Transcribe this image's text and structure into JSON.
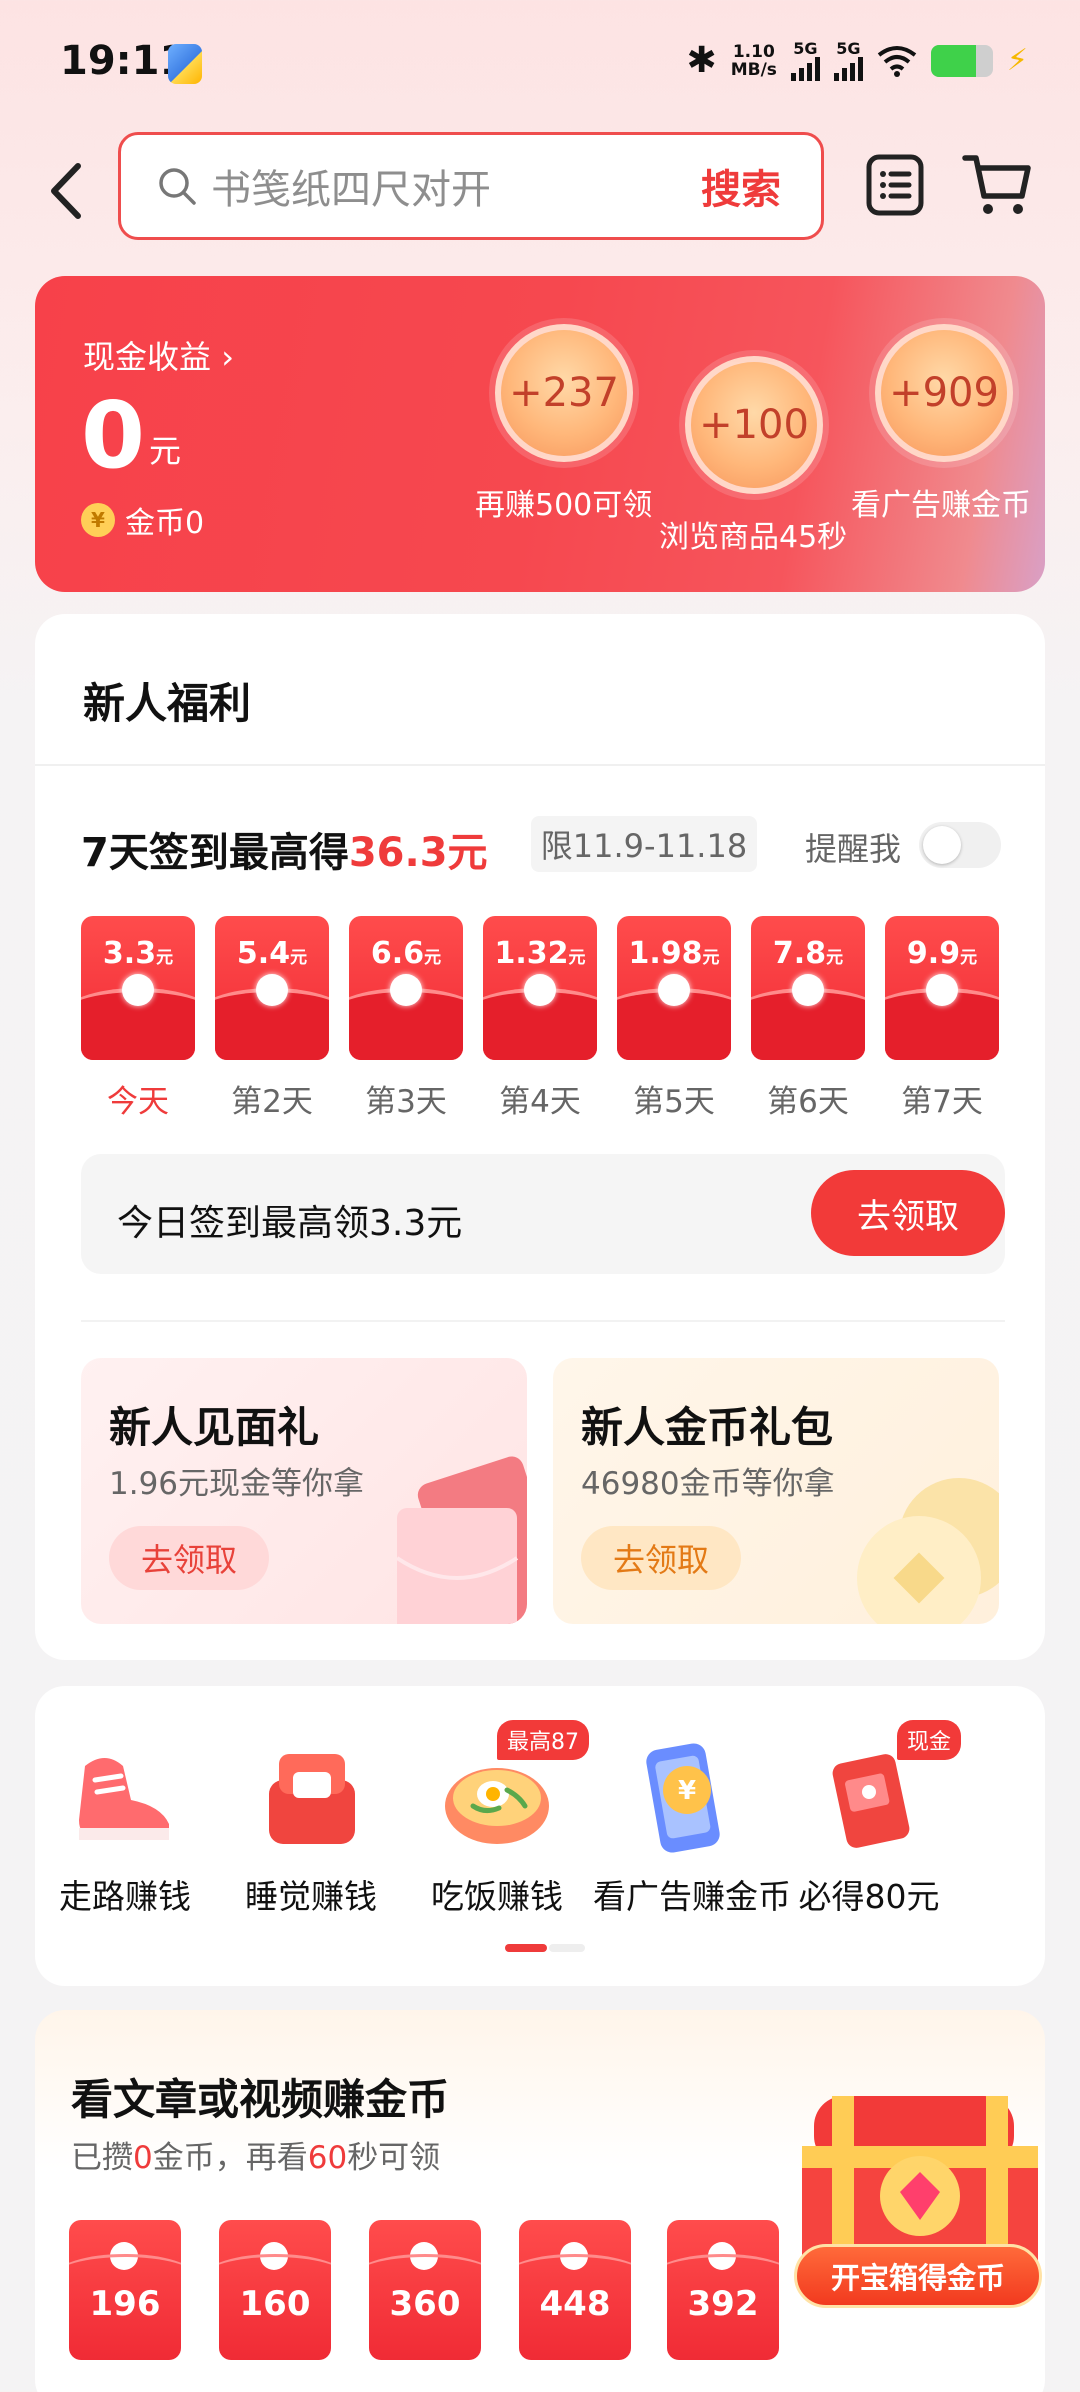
{
  "status_bar": {
    "time": "19:11",
    "net_speed_value": "1.10",
    "net_speed_unit": "MB/s",
    "sim1": "5G",
    "sim2": "5G"
  },
  "search": {
    "placeholder": "书笺纸四尺对开",
    "button_label": "搜索"
  },
  "cash_card": {
    "title": "现金收益",
    "amount": "0",
    "unit": "元",
    "coins_label": "金币0",
    "coin_symbol": "¥",
    "bubbles": [
      {
        "value": "+237",
        "label": "再赚500可领"
      },
      {
        "value": "+100",
        "label": "浏览商品45秒"
      },
      {
        "value": "+909",
        "label": "看广告赚金币"
      }
    ]
  },
  "welfare": {
    "title": "新人福利",
    "signin_prefix": "7天签到最高得",
    "signin_highlight": "36.3元",
    "limit": "限11.9-11.18",
    "remind_label": "提醒我",
    "remind_on": false,
    "days": [
      {
        "amount": "3.3",
        "unit": "元",
        "label": "今天"
      },
      {
        "amount": "5.4",
        "unit": "元",
        "label": "第2天"
      },
      {
        "amount": "6.6",
        "unit": "元",
        "label": "第3天"
      },
      {
        "amount": "1.32",
        "unit": "元",
        "label": "第4天"
      },
      {
        "amount": "1.98",
        "unit": "元",
        "label": "第5天"
      },
      {
        "amount": "7.8",
        "unit": "元",
        "label": "第6天"
      },
      {
        "amount": "9.9",
        "unit": "元",
        "label": "第7天"
      }
    ],
    "today_text": "今日签到最高领3.3元",
    "claim_label": "去领取",
    "gifts": [
      {
        "title": "新人见面礼",
        "subtitle": "1.96元现金等你拿",
        "button": "去领取"
      },
      {
        "title": "新人金币礼包",
        "subtitle": "46980金币等你拿",
        "button": "去领取"
      }
    ]
  },
  "earn": {
    "items": [
      {
        "label": "走路赚钱",
        "icon": "sneaker-icon",
        "badge": ""
      },
      {
        "label": "睡觉赚钱",
        "icon": "pillow-icon",
        "badge": ""
      },
      {
        "label": "吃饭赚钱",
        "icon": "noodle-bowl-icon",
        "badge": "最高87"
      },
      {
        "label": "看广告赚金币",
        "icon": "phone-coin-icon",
        "badge": ""
      },
      {
        "label": "必得80元",
        "icon": "red-packet-icon",
        "badge": "现金"
      }
    ]
  },
  "video": {
    "title": "看文章或视频赚金币",
    "sub_prefix": "已攒",
    "sub_coins": "0",
    "sub_mid": "金币，再看",
    "sub_seconds": "60",
    "sub_suffix": "秒可领",
    "rewards": [
      {
        "value": "196"
      },
      {
        "value": "160"
      },
      {
        "value": "360"
      },
      {
        "value": "448"
      },
      {
        "value": "392"
      }
    ],
    "treasure_label": "开宝箱得金币"
  },
  "colors": {
    "accent": "#ef3b3b",
    "card_red": "#f7414a",
    "gold": "#e37a16"
  }
}
